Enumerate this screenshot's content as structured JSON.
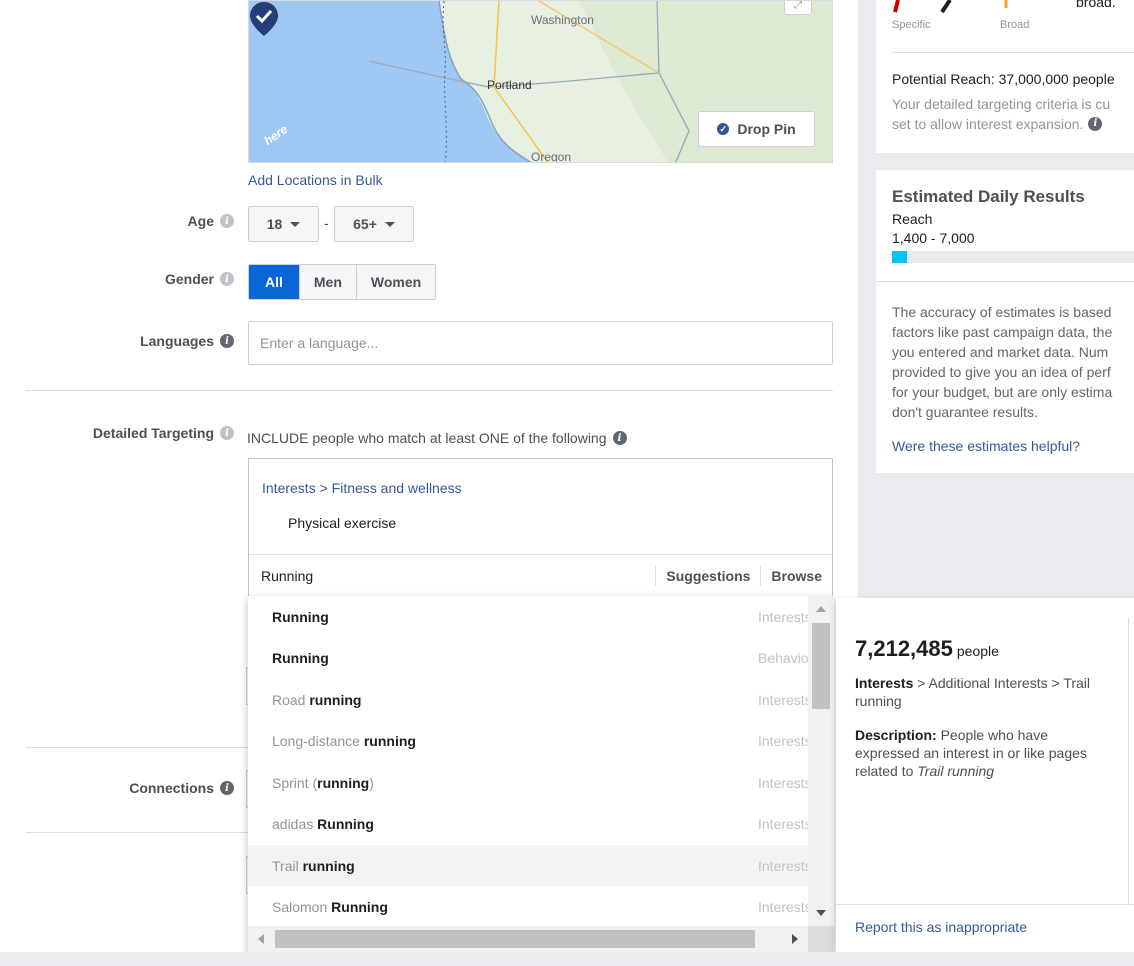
{
  "map": {
    "labels": {
      "washington": "Washington",
      "portland": "Portland",
      "oregon": "Oregon",
      "attribution": "here"
    },
    "drop_pin_label": "Drop Pin"
  },
  "location": {
    "add_bulk_link": "Add Locations in Bulk"
  },
  "age": {
    "label": "Age",
    "min": "18",
    "dash": "-",
    "max": "65+"
  },
  "gender": {
    "label": "Gender",
    "options": [
      "All",
      "Men",
      "Women"
    ],
    "selected": "All"
  },
  "languages": {
    "label": "Languages",
    "placeholder": "Enter a language..."
  },
  "detailed_targeting": {
    "label": "Detailed Targeting",
    "include_text": "INCLUDE people who match at least ONE of the following",
    "breadcrumb": {
      "category": "Interests",
      "separator": ">",
      "subcategory": "Fitness and wellness"
    },
    "selected_item": "Physical exercise",
    "search_value": "Running",
    "tabs": [
      "Suggestions",
      "Browse"
    ]
  },
  "connections": {
    "label": "Connections"
  },
  "dropdown": {
    "items": [
      {
        "prefix": "",
        "match": "Running",
        "suffix": "",
        "category": "Interests"
      },
      {
        "prefix": "",
        "match": "Running",
        "suffix": "",
        "category": "Behaviors"
      },
      {
        "prefix": "Road ",
        "match": "running",
        "suffix": "",
        "category": "Interests"
      },
      {
        "prefix": "Long-distance ",
        "match": "running",
        "suffix": "",
        "category": "Interests"
      },
      {
        "prefix": "Sprint (",
        "match": "running",
        "suffix": ")",
        "category": "Interests"
      },
      {
        "prefix": "adidas ",
        "match": "Running",
        "suffix": "",
        "category": "Interests"
      },
      {
        "prefix": "Trail ",
        "match": "running",
        "suffix": "",
        "category": "Interests"
      },
      {
        "prefix": "Salomon ",
        "match": "Running",
        "suffix": "",
        "category": "Interests"
      }
    ],
    "highlighted_index": 6
  },
  "detail": {
    "count": "7,212,485",
    "unit": "people",
    "path_bold": "Interests",
    "path_rest": "> Additional Interests > Trail running",
    "desc_label": "Description:",
    "desc_text": "People who have expressed an interest in or like pages related to",
    "desc_topic": "Trail running",
    "report_link": "Report this as inappropriate"
  },
  "audience_card": {
    "meter_specific": "Specific",
    "meter_broad": "Broad",
    "meter_top_text": "broad.",
    "potential_reach": "Potential Reach: 37,000,000 people",
    "desc_line1": "Your detailed targeting criteria is cu",
    "desc_line2": "set to allow interest expansion."
  },
  "daily_results": {
    "title": "Estimated Daily Results",
    "reach_label": "Reach",
    "reach_range": "1,400 - 7,000",
    "reach_fill": 0.06,
    "accuracy_lines": [
      "The accuracy of estimates is based",
      "factors like past campaign data, the",
      "you entered and market data. Num",
      "provided to give you an idea of perf",
      "for your budget, but are only estima",
      "don't guarantee results."
    ],
    "helpful_link": "Were these estimates helpful?"
  },
  "colors": {
    "accent_blue": "#0866d6",
    "link_blue": "#365899",
    "reach_bar": "#00c4f5",
    "meter_red": "#c00000",
    "meter_orange": "#f5a623"
  }
}
